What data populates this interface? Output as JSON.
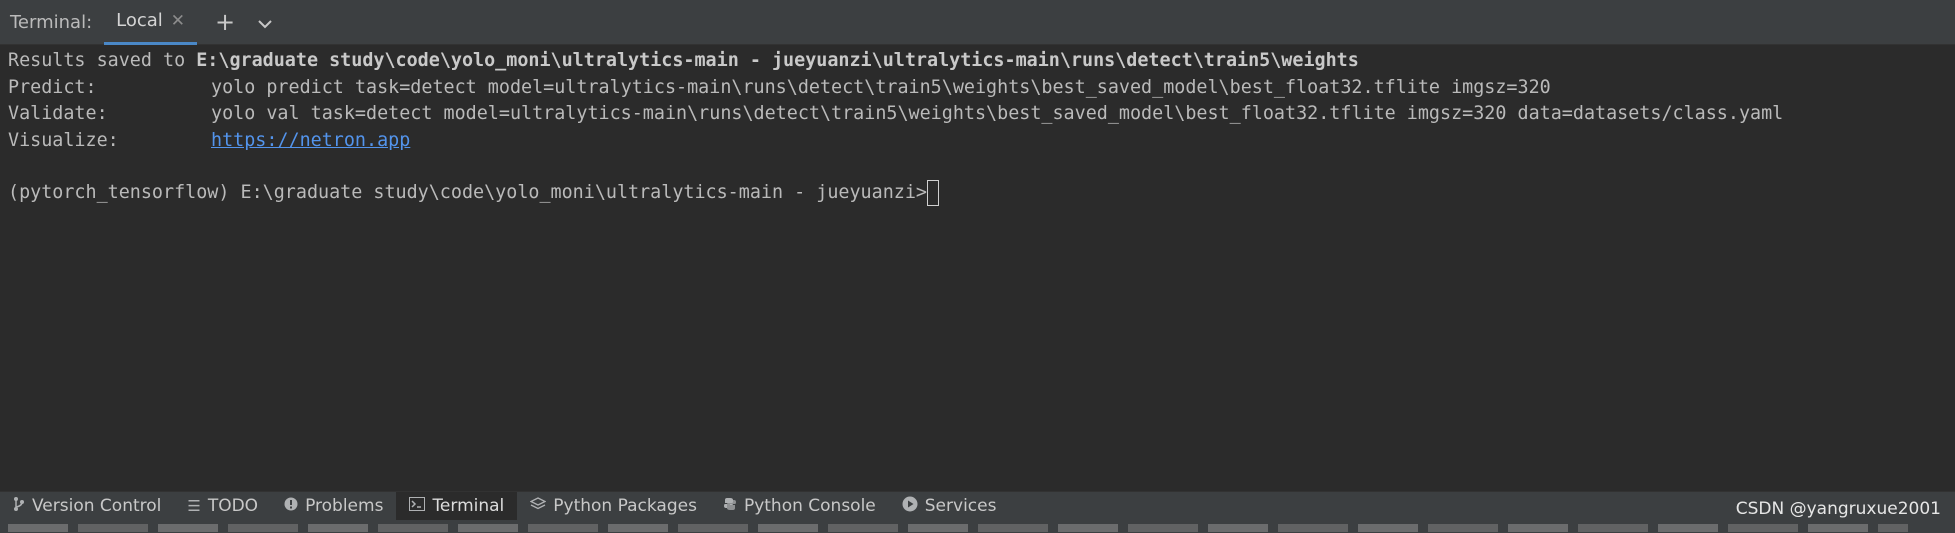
{
  "header": {
    "title": "Terminal:",
    "tab_label": "Local",
    "close_glyph": "✕",
    "add_glyph": "+",
    "dropdown_glyph": "⌄"
  },
  "terminal": {
    "line1_label": "Results saved to ",
    "line1_path": "E:\\graduate study\\code\\yolo_moni\\ultralytics-main - jueyuanzi\\ultralytics-main\\runs\\detect\\train5\\weights",
    "line2_label": "Predict:",
    "line2_value": "yolo predict task=detect model=ultralytics-main\\runs\\detect\\train5\\weights\\best_saved_model\\best_float32.tflite imgsz=320",
    "line3_label": "Validate:",
    "line3_value": "yolo val task=detect model=ultralytics-main\\runs\\detect\\train5\\weights\\best_saved_model\\best_float32.tflite imgsz=320 data=datasets/class.yaml",
    "line4_label": "Visualize:",
    "line4_link": "https://netron.app",
    "prompt": "(pytorch_tensorflow) E:\\graduate study\\code\\yolo_moni\\ultralytics-main - jueyuanzi>"
  },
  "toolbar": {
    "items": [
      {
        "label": "Version Control",
        "icon": "branch-icon"
      },
      {
        "label": "TODO",
        "icon": "list-icon"
      },
      {
        "label": "Problems",
        "icon": "warning-icon"
      },
      {
        "label": "Terminal",
        "icon": "terminal-icon"
      },
      {
        "label": "Python Packages",
        "icon": "layers-icon"
      },
      {
        "label": "Python Console",
        "icon": "python-icon"
      },
      {
        "label": "Services",
        "icon": "play-icon"
      }
    ]
  },
  "watermark": "CSDN @yangruxue2001",
  "colors": {
    "background": "#2b2b2b",
    "panel": "#3c3f41",
    "link": "#5394ec",
    "tab_underline": "#4a88c7"
  }
}
